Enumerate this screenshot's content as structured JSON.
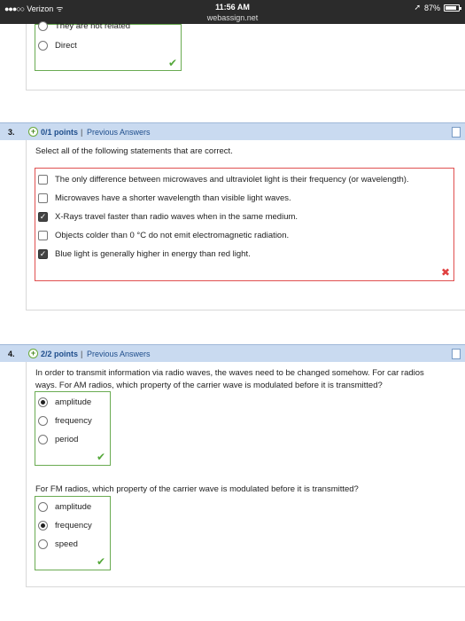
{
  "status": {
    "carrier": "Verizon",
    "signal_dots": "●●●○○",
    "wifi_glyph": "ᯤ",
    "time": "11:56 AM",
    "url": "webassign.net",
    "location_glyph": "➚",
    "battery_text": "87%",
    "battery_level": 0.87
  },
  "q2": {
    "options": [
      "They are not related",
      "Direct"
    ],
    "ok_mark": "✔"
  },
  "q3": {
    "number": "3.",
    "plus": "+",
    "points": "0/1 points",
    "sep": "|",
    "prev": "Previous Answers",
    "prompt": "Select all of the following statements that are correct.",
    "options": [
      {
        "label": "The only difference between microwaves and ultraviolet light is their frequency (or wavelength).",
        "checked": false
      },
      {
        "label": "Microwaves have a shorter wavelength than visible light waves.",
        "checked": false
      },
      {
        "label": "X-Rays travel faster than radio waves when in the same medium.",
        "checked": true
      },
      {
        "label": "Objects colder than 0 °C do not emit electromagnetic radiation.",
        "checked": false
      },
      {
        "label": "Blue light is generally higher in energy than red light.",
        "checked": true
      }
    ],
    "check_glyph": "✓",
    "wrong_mark": "✖"
  },
  "q4": {
    "number": "4.",
    "plus": "+",
    "points": "2/2 points",
    "sep": "|",
    "prev": "Previous Answers",
    "prompt_line1": "In order to transmit information via radio waves, the waves need to be changed somehow. For car radios",
    "prompt_line2": "ways. For AM radios, which property of the carrier wave is modulated before it is transmitted?",
    "am_options": [
      "amplitude",
      "frequency",
      "period"
    ],
    "fm_prompt": "For FM radios, which property of the carrier wave is modulated before it is transmitted?",
    "fm_options": [
      "amplitude",
      "frequency",
      "speed"
    ],
    "ok_mark": "✔"
  },
  "colors": {
    "header_bg": "#c9daf0",
    "link": "#1f4e8c",
    "correct": "#6aab52",
    "incorrect": "#e05050"
  }
}
